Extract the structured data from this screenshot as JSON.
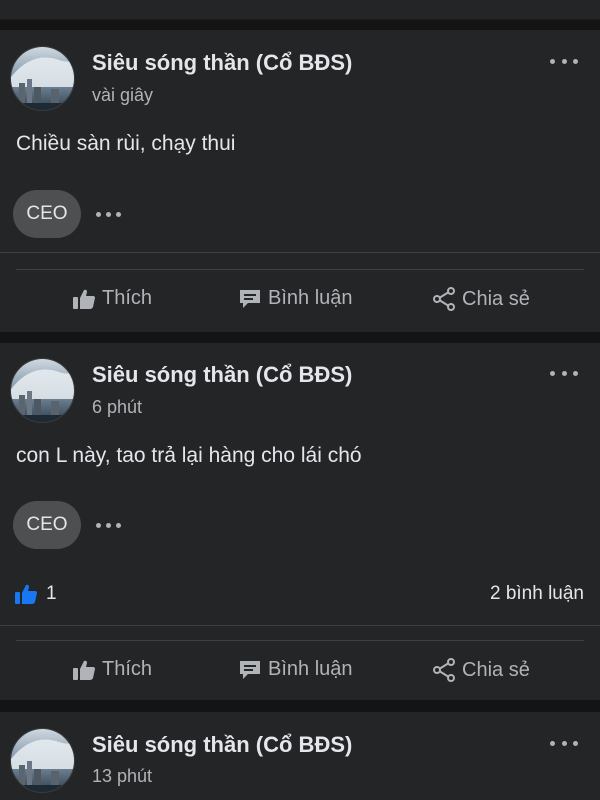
{
  "posts": [
    {
      "author": "Siêu sóng thần (Cổ BĐS)",
      "time": "vài giây",
      "content": "Chiều sàn rùi, chạy thui",
      "badge": "CEO"
    },
    {
      "author": "Siêu sóng thần (Cổ BĐS)",
      "time": "6 phút",
      "content": "con L này, tao trả lại hàng cho lái chó",
      "badge": "CEO",
      "like_count": "1",
      "comment_count": "2 bình luận"
    },
    {
      "author": "Siêu sóng thần (Cổ BĐS)",
      "time": "13 phút"
    }
  ],
  "actions": {
    "like": "Thích",
    "comment": "Bình luận",
    "share": "Chia sẻ"
  },
  "icons": {
    "like": "thumbs-up-icon",
    "comment": "comment-bubble-icon",
    "share": "share-icon",
    "more": "more-options-icon",
    "reaction": "like-reaction-icon"
  },
  "colors": {
    "background": "#141414",
    "card": "#242526",
    "text": "#e4e6eb",
    "secondary_text": "#b0b3b8",
    "like_blue": "#1877f2"
  }
}
